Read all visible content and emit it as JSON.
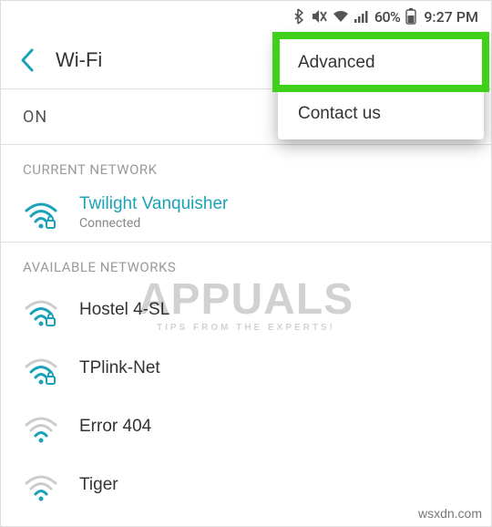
{
  "status": {
    "battery_pct": "60%",
    "time": "9:27 PM"
  },
  "header": {
    "title": "Wi-Fi"
  },
  "toggle": {
    "label": "ON"
  },
  "menu": {
    "advanced": "Advanced",
    "contact": "Contact us"
  },
  "sections": {
    "current": "CURRENT NETWORK",
    "available": "AVAILABLE NETWORKS"
  },
  "current_network": {
    "ssid": "Twilight Vanquisher",
    "status": "Connected"
  },
  "available": [
    {
      "ssid": "Hostel 4-SL",
      "secured": true,
      "strength": 3
    },
    {
      "ssid": "TPlink-Net",
      "secured": true,
      "strength": 3
    },
    {
      "ssid": "Error 404",
      "secured": false,
      "strength": 2
    },
    {
      "ssid": "Tiger",
      "secured": false,
      "strength": 2
    }
  ],
  "watermark": {
    "main": "APPUALS",
    "sub": "TIPS FROM THE EXPERTS!",
    "site": "wsxdn.com"
  },
  "colors": {
    "accent": "#1aa3b8",
    "highlight": "#3fd11a"
  }
}
